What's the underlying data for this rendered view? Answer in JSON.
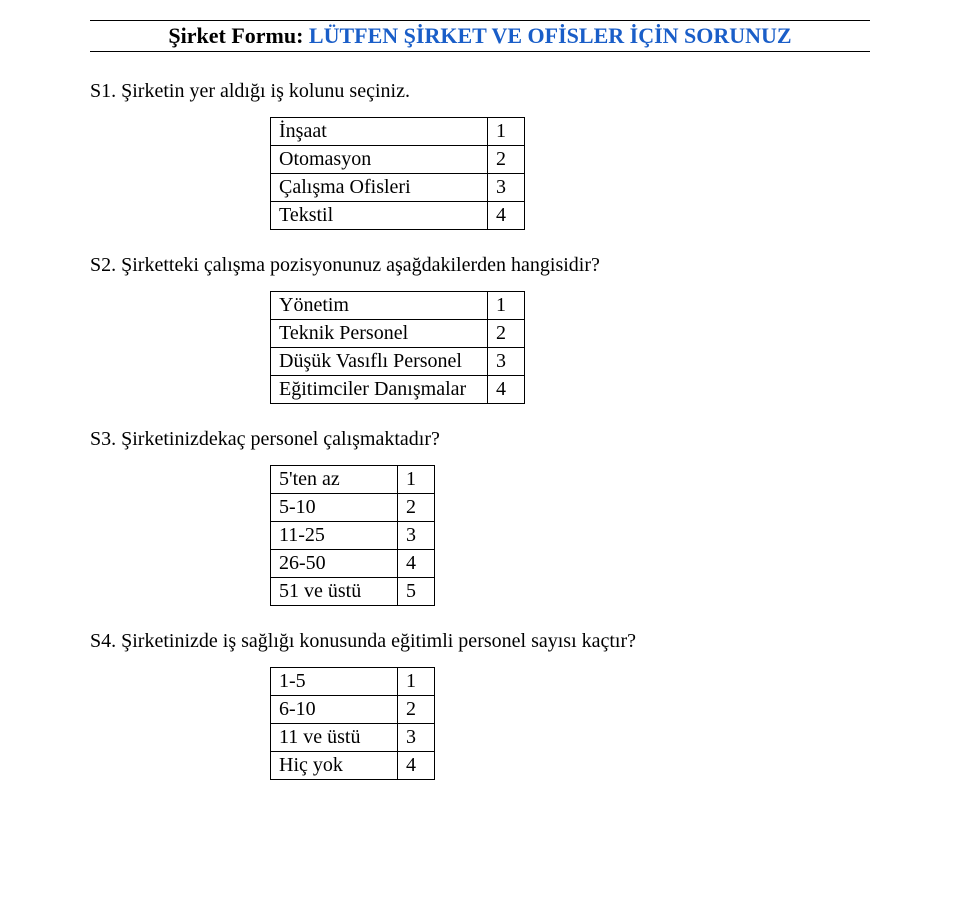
{
  "header": {
    "prefix": "Şirket Formu: ",
    "emphasis": "LÜTFEN ŞİRKET VE OFİSLER İÇİN SORUNUZ"
  },
  "questions": {
    "s1": {
      "text": "S1. Şirketin yer aldığı iş kolunu seçiniz.",
      "options": [
        {
          "label": "İnşaat",
          "code": "1"
        },
        {
          "label": "Otomasyon",
          "code": "2"
        },
        {
          "label": "Çalışma Ofisleri",
          "code": "3"
        },
        {
          "label": "Tekstil",
          "code": "4"
        }
      ]
    },
    "s2": {
      "text": "S2. Şirketteki çalışma pozisyonunuz aşağdakilerden hangisidir?",
      "options": [
        {
          "label": "Yönetim",
          "code": "1"
        },
        {
          "label": "Teknik Personel",
          "code": "2"
        },
        {
          "label": "Düşük Vasıflı Personel",
          "code": "3"
        },
        {
          "label": "Eğitimciler Danışmalar",
          "code": "4"
        }
      ]
    },
    "s3": {
      "text": "S3. Şirketinizdekaç personel çalışmaktadır?",
      "options": [
        {
          "label": "5'ten az",
          "code": "1"
        },
        {
          "label": "5-10",
          "code": "2"
        },
        {
          "label": "11-25",
          "code": "3"
        },
        {
          "label": "26-50",
          "code": "4"
        },
        {
          "label": "51 ve üstü",
          "code": "5"
        }
      ]
    },
    "s4": {
      "text": "S4. Şirketinizde iş sağlığı konusunda eğitimli personel sayısı kaçtır?",
      "options": [
        {
          "label": "1-5",
          "code": "1"
        },
        {
          "label": "6-10",
          "code": "2"
        },
        {
          "label": "11 ve üstü",
          "code": "3"
        },
        {
          "label": "Hiç yok",
          "code": "4"
        }
      ]
    }
  }
}
